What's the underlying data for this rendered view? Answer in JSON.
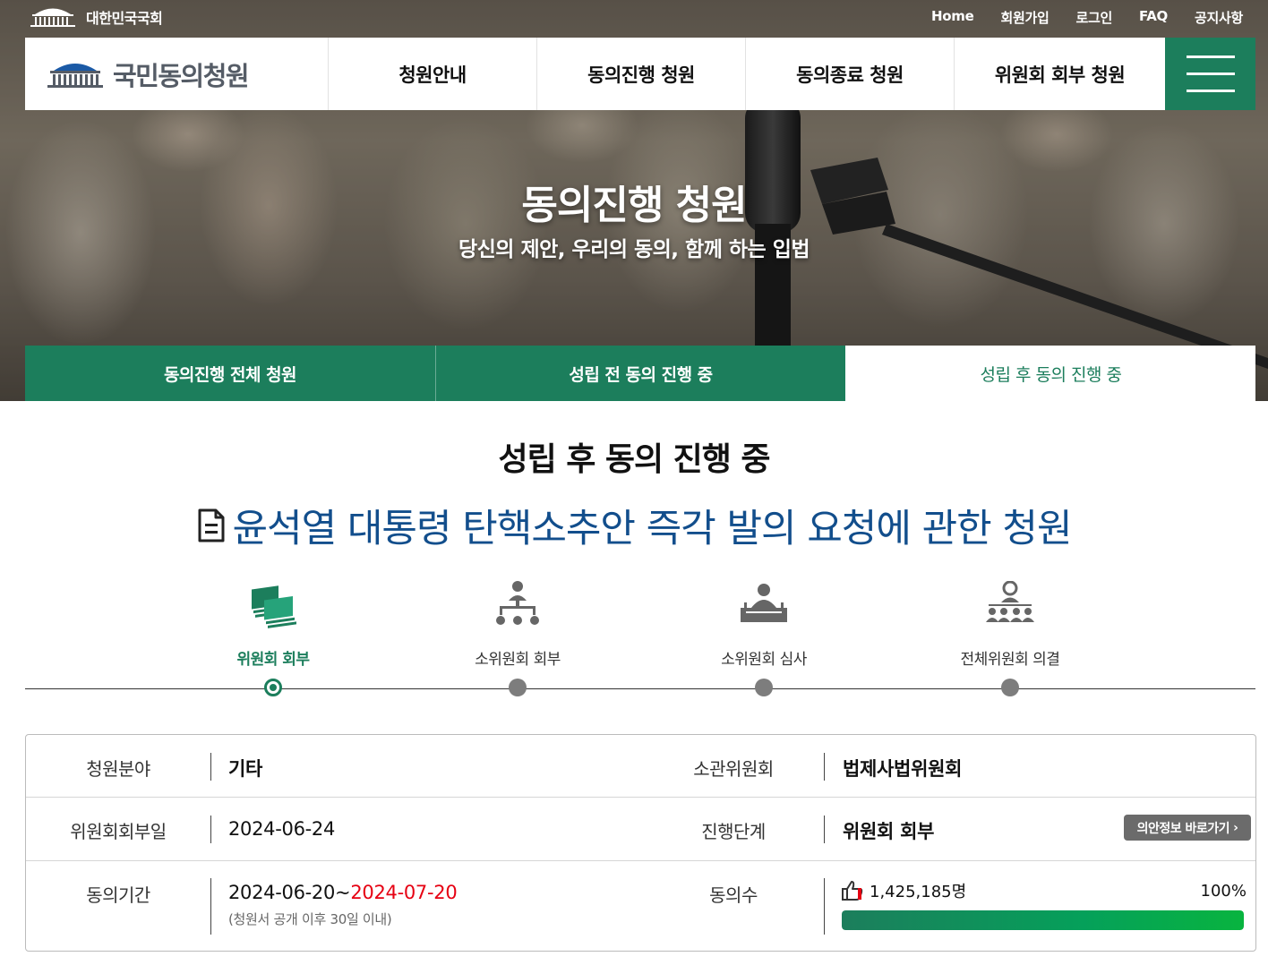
{
  "top": {
    "org_name": "대한민국국회",
    "utility_links": [
      "Home",
      "회원가입",
      "로그인",
      "FAQ",
      "공지사항"
    ]
  },
  "gnb": {
    "logo_text": "국민동의청원",
    "menu": [
      "청원안내",
      "동의진행 청원",
      "동의종료 청원",
      "위원회 회부 청원"
    ]
  },
  "hero": {
    "title": "동의진행 청원",
    "subtitle": "당신의 제안, 우리의 동의, 함께 하는 입법"
  },
  "subtabs": {
    "items": [
      "동의진행 전체 청원",
      "성립 전 동의 진행 중",
      "성립 후 동의 진행 중"
    ],
    "active_index": 2
  },
  "section_title": "성립 후 동의 진행 중",
  "petition": {
    "title": "윤석열 대통령 탄핵소추안 즉각 발의 요청에 관한 청원"
  },
  "steps": {
    "items": [
      {
        "label": "위원회 회부",
        "icon": "committee-referral-icon"
      },
      {
        "label": "소위원회 회부",
        "icon": "subcommittee-referral-icon"
      },
      {
        "label": "소위원회 심사",
        "icon": "subcommittee-review-icon"
      },
      {
        "label": "전체위원회 의결",
        "icon": "plenary-committee-icon"
      }
    ],
    "active_index": 0
  },
  "info": {
    "field_label": "청원분야",
    "field_value": "기타",
    "committee_label": "소관위원회",
    "committee_value": "법제사법위원회",
    "referral_date_label": "위원회회부일",
    "referral_date_value": "2024-06-24",
    "stage_label": "진행단계",
    "stage_value": "위원회 회부",
    "bill_info_button": "의안정보 바로가기",
    "period_label": "동의기간",
    "period_start": "2024-06-20~",
    "period_end": "2024-07-20",
    "period_note": "(청원서 공개 이후 30일 이내)",
    "agree_label": "동의수",
    "agree_count": "1,425,185명",
    "agree_percent_text": "100%",
    "agree_progress": 1.0
  },
  "colors": {
    "brand_green": "#1c7e5c",
    "title_blue": "#124e8c",
    "deadline_red": "#e60012"
  }
}
